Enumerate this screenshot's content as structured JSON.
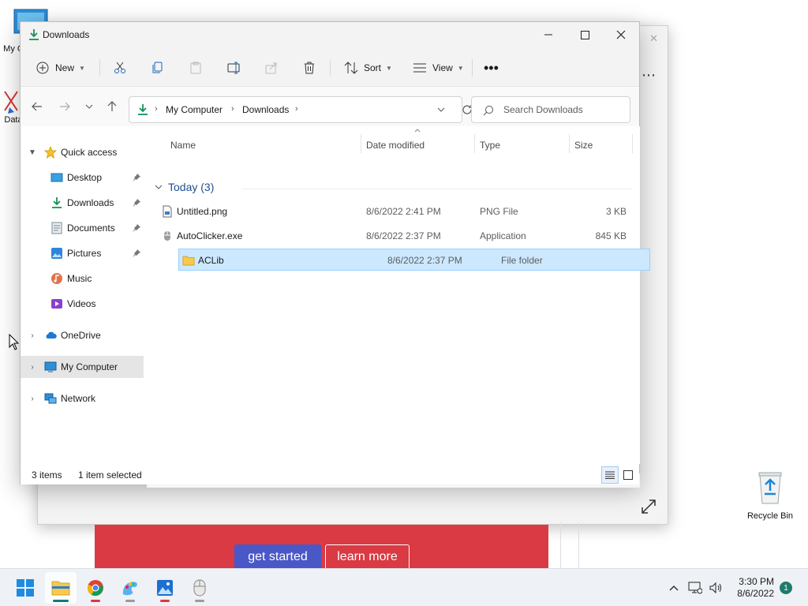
{
  "desktop": {
    "my_computer_label": "My C",
    "data_label": "Data",
    "recycle_bin_label": "Recycle Bin"
  },
  "background": {
    "get_started": "get started",
    "learn_more": "learn more"
  },
  "window": {
    "title": "Downloads"
  },
  "toolbar": {
    "new_label": "New",
    "sort_label": "Sort",
    "view_label": "View"
  },
  "address": {
    "crumbs": [
      "My Computer",
      "Downloads"
    ]
  },
  "search": {
    "placeholder": "Search Downloads"
  },
  "sidebar": {
    "quick_access": "Quick access",
    "items": [
      {
        "label": "Desktop",
        "icon": "desktop-icon",
        "pinned": true
      },
      {
        "label": "Downloads",
        "icon": "download-icon",
        "pinned": true
      },
      {
        "label": "Documents",
        "icon": "documents-icon",
        "pinned": true
      },
      {
        "label": "Pictures",
        "icon": "pictures-icon",
        "pinned": true
      },
      {
        "label": "Music",
        "icon": "music-icon",
        "pinned": false
      },
      {
        "label": "Videos",
        "icon": "videos-icon",
        "pinned": false
      }
    ],
    "onedrive": "OneDrive",
    "my_computer": "My Computer",
    "network": "Network"
  },
  "columns": {
    "name": "Name",
    "date": "Date modified",
    "type": "Type",
    "size": "Size"
  },
  "group": {
    "label": "Today (3)"
  },
  "files": [
    {
      "name": "Untitled.png",
      "date": "8/6/2022 2:41 PM",
      "type": "PNG File",
      "size": "3 KB",
      "icon": "image-file-icon",
      "selected": false
    },
    {
      "name": "AutoClicker.exe",
      "date": "8/6/2022 2:37 PM",
      "type": "Application",
      "size": "845 KB",
      "icon": "app-file-icon",
      "selected": false
    },
    {
      "name": "ACLib",
      "date": "8/6/2022 2:37 PM",
      "type": "File folder",
      "size": "",
      "icon": "folder-icon",
      "selected": true
    }
  ],
  "status": {
    "count": "3 items",
    "selection": "1 item selected"
  },
  "taskbar": {
    "time": "3:30 PM",
    "date": "8/6/2022",
    "notifications": "1"
  },
  "colors": {
    "accent": "#0067c0",
    "selection": "#cce8ff",
    "folder": "#f8c94a"
  }
}
